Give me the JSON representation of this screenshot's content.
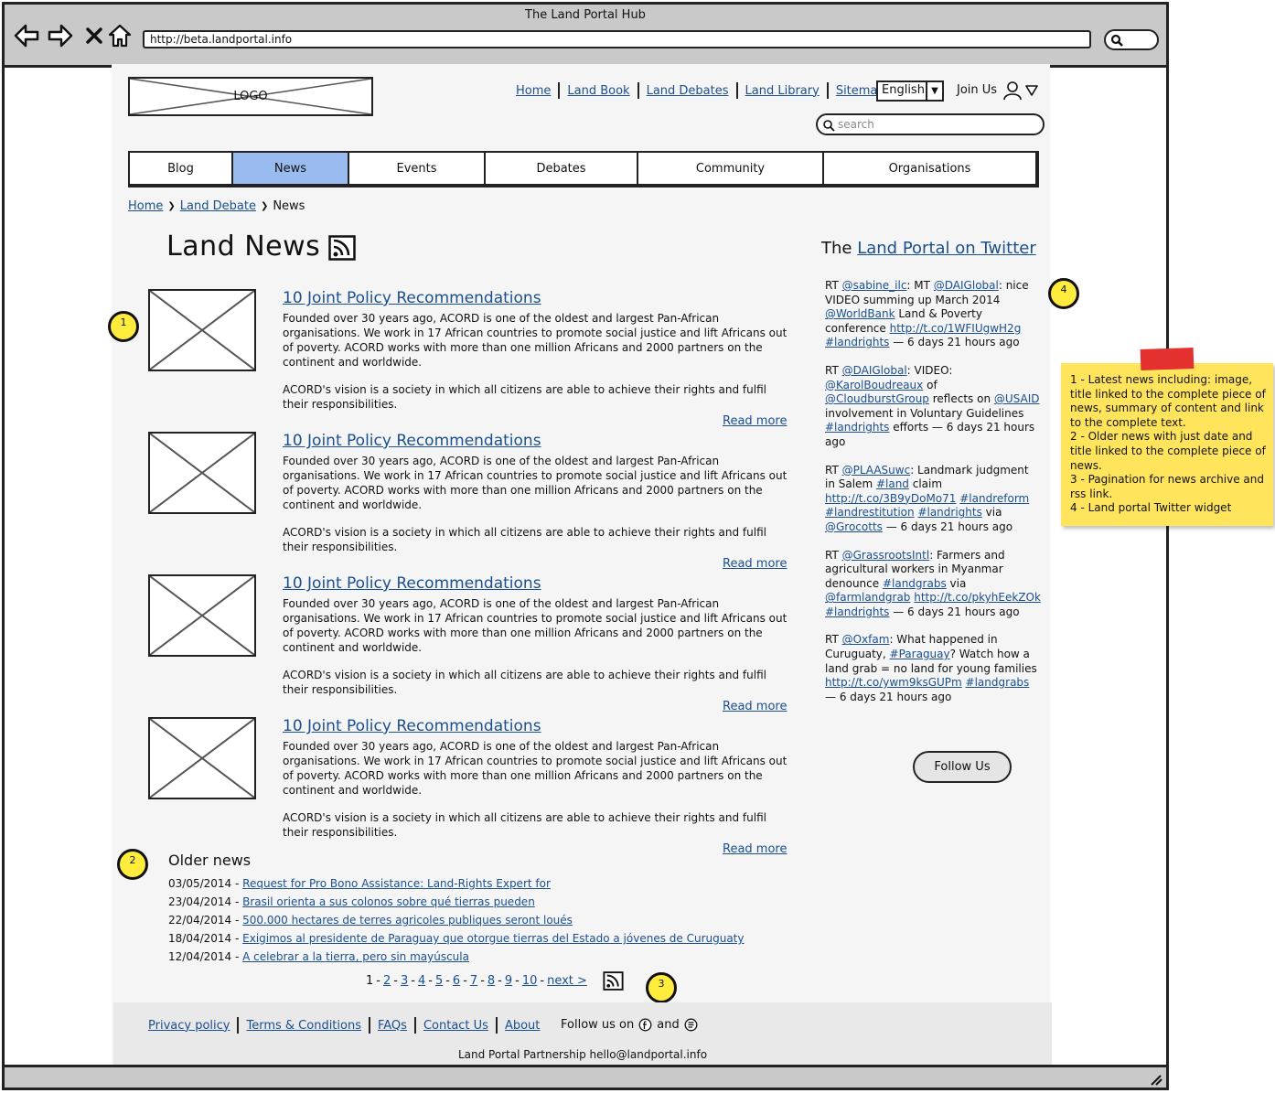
{
  "browser": {
    "title": "The Land Port​al Hub",
    "url": "http://beta.landportal.info"
  },
  "header": {
    "logo_text": "LOGO",
    "nav": [
      "Home",
      "Land Book",
      "Land Debates",
      "Land Library",
      "Sitemap"
    ],
    "language": "English",
    "join_us": "Join Us",
    "search_placeholder": "search"
  },
  "tabs": [
    {
      "label": "Blog",
      "active": false
    },
    {
      "label": "News",
      "active": true
    },
    {
      "label": "Events",
      "active": false
    },
    {
      "label": "Debates",
      "active": false
    },
    {
      "label": "Community",
      "active": false
    },
    {
      "label": "Organisations",
      "active": false
    }
  ],
  "breadcrumb": {
    "home": "Home",
    "section": "Land Debate",
    "current": "News",
    "sep": "❯"
  },
  "main": {
    "title": "Land News",
    "news_items": [
      {
        "title": "10 Joint Policy Recommendations",
        "para1": "Founded over 30 years ago, ACORD is one of the oldest and largest Pan-African organisations. We work in 17 African countries to promote social justice and lift Africans out of poverty. ACORD works with more than one million Africans and 2000 partners on the continent and worldwide.",
        "para2": "ACORD's vision is a society in which all citizens are able to achieve their rights and fulfil their responsibilities.",
        "read_more": "Read more"
      },
      {
        "title": "10 Joint Policy Recommendations",
        "para1": "Founded over 30 years ago, ACORD is one of the oldest and largest Pan-African organisations. We work in 17 African countries to promote social justice and lift Africans out of poverty. ACORD works with more than one million Africans and 2000 partners on the continent and worldwide.",
        "para2": "ACORD's vision is a society in which all citizens are able to achieve their rights and fulfil their responsibilities.",
        "read_more": "Read more"
      },
      {
        "title": "10 Joint Policy Recommendations",
        "para1": "Founded over 30 years ago, ACORD is one of the oldest and largest Pan-African organisations. We work in 17 African countries to promote social justice and lift Africans out of poverty. ACORD works with more than one million Africans and 2000 partners on the continent and worldwide.",
        "para2": "ACORD's vision is a society in which all citizens are able to achieve their rights and fulfil their responsibilities.",
        "read_more": "Read more"
      },
      {
        "title": "10 Joint Policy Recommendations",
        "para1": "Founded over 30 years ago, ACORD is one of the oldest and largest Pan-African organisations. We work in 17 African countries to promote social justice and lift Africans out of poverty. ACORD works with more than one million Africans and 2000 partners on the continent and worldwide.",
        "para2": "ACORD's vision is a society in which all citizens are able to achieve their rights and fulfil their responsibilities.",
        "read_more": "Read more"
      }
    ],
    "older_news_title": "Older news",
    "older_news": [
      {
        "date": "03/05/2014",
        "title": "Request for Pro Bono Assistance: Land-Rights Expert for"
      },
      {
        "date": "23/04/2014",
        "title": "Brasil orienta a sus colonos sobre qué tierras pueden"
      },
      {
        "date": "22/04/2014",
        "title": "500.000 hectares de terres agricoles publiques seront loués"
      },
      {
        "date": "18/04/2014",
        "title": "Exigimos al presidente de Paraguay que otorgue tierras del Estado a jóvenes de Curuguaty"
      },
      {
        "date": "12/04/2014",
        "title": "A celebrar a la tierra, pero sin mayúscula"
      }
    ],
    "pagination": {
      "current": "1",
      "pages": [
        "2",
        "3",
        "4",
        "5",
        "6",
        "7",
        "8",
        "9",
        "10"
      ],
      "next": "next >"
    }
  },
  "callouts": [
    "1",
    "2",
    "3",
    "4"
  ],
  "twitter": {
    "title_prefix": "The",
    "title_link": "Land Portal on Twitter",
    "follow_label": "Follow Us",
    "tweets": [
      [
        {
          "t": "RT "
        },
        {
          "t": "@sabine_ilc",
          "l": 1
        },
        {
          "t": ": MT "
        },
        {
          "t": "@DAIGlobal",
          "l": 1
        },
        {
          "t": ": nice VIDEO summing up March 2014 "
        },
        {
          "t": "@WorldBank",
          "l": 1
        },
        {
          "t": " Land & Poverty conference "
        },
        {
          "t": "http://t.co/1WFIUgwH2g",
          "l": 1
        },
        {
          "t": " "
        },
        {
          "t": "#landrights",
          "l": 1
        },
        {
          "t": " — 6 days 21 hours ago"
        }
      ],
      [
        {
          "t": "RT "
        },
        {
          "t": "@DAIGlobal",
          "l": 1
        },
        {
          "t": ": VIDEO: "
        },
        {
          "t": "@KarolBoudreaux",
          "l": 1
        },
        {
          "t": " of "
        },
        {
          "t": "@CloudburstGroup",
          "l": 1
        },
        {
          "t": " reflects on "
        },
        {
          "t": "@USAID",
          "l": 1
        },
        {
          "t": " involvement in Voluntary Guidelines "
        },
        {
          "t": "#landrights",
          "l": 1
        },
        {
          "t": " efforts — 6 days 21 hours ago"
        }
      ],
      [
        {
          "t": "RT "
        },
        {
          "t": "@PLAASuwc",
          "l": 1
        },
        {
          "t": ": Landmark judgment in Salem "
        },
        {
          "t": "#land",
          "l": 1
        },
        {
          "t": " claim "
        },
        {
          "t": "http://t.co/3B9yDoMo71",
          "l": 1
        },
        {
          "t": " "
        },
        {
          "t": "#landreform",
          "l": 1
        },
        {
          "t": " "
        },
        {
          "t": "#landrestitution",
          "l": 1
        },
        {
          "t": " "
        },
        {
          "t": "#landrights",
          "l": 1
        },
        {
          "t": " via "
        },
        {
          "t": "@Grocotts",
          "l": 1
        },
        {
          "t": " — 6 days 21 hours ago"
        }
      ],
      [
        {
          "t": "RT "
        },
        {
          "t": "@GrassrootsIntl",
          "l": 1
        },
        {
          "t": ": Farmers and agricultural workers in Myanmar denounce "
        },
        {
          "t": "#landgrabs",
          "l": 1
        },
        {
          "t": " via "
        },
        {
          "t": "@farmlandgrab",
          "l": 1
        },
        {
          "t": " "
        },
        {
          "t": "http://t.co/pkyhEekZOk",
          "l": 1
        },
        {
          "t": " "
        },
        {
          "t": "#landrights",
          "l": 1
        },
        {
          "t": " — 6 days 21 hours ago"
        }
      ],
      [
        {
          "t": "RT "
        },
        {
          "t": "@Oxfam",
          "l": 1
        },
        {
          "t": ": What happened in Curuguaty, "
        },
        {
          "t": "#Paraguay",
          "l": 1
        },
        {
          "t": "? Watch how a land grab = no land for young families "
        },
        {
          "t": "http://t.co/ywm9ksGUPm",
          "l": 1
        },
        {
          "t": " "
        },
        {
          "t": "#landgrabs",
          "l": 1
        },
        {
          "t": " — 6 days 21 hours ago"
        }
      ]
    ]
  },
  "footer": {
    "links": [
      "Privacy policy",
      "Terms & Conditions",
      "FAQs",
      "Contact Us",
      "About"
    ],
    "follow_text": "Follow us on",
    "and_text": "and",
    "partnership": "Land Portal Partnership hello@landportal.info"
  },
  "note": {
    "lines": [
      "1 - Latest news including: image, title linked to the complete piece of news, summary of content and link to the complete text.",
      "2 - Older news with just date and title linked to the complete piece of news.",
      "3 - Pagination for news archive and rss link.",
      "4 - Land portal Twitter widget"
    ]
  },
  "colors": {
    "link": "#1a4f8f",
    "active_tab": "#99bbf0",
    "note": "#ffe45c",
    "tape": "#e53030",
    "callout": "#ffec3d"
  }
}
